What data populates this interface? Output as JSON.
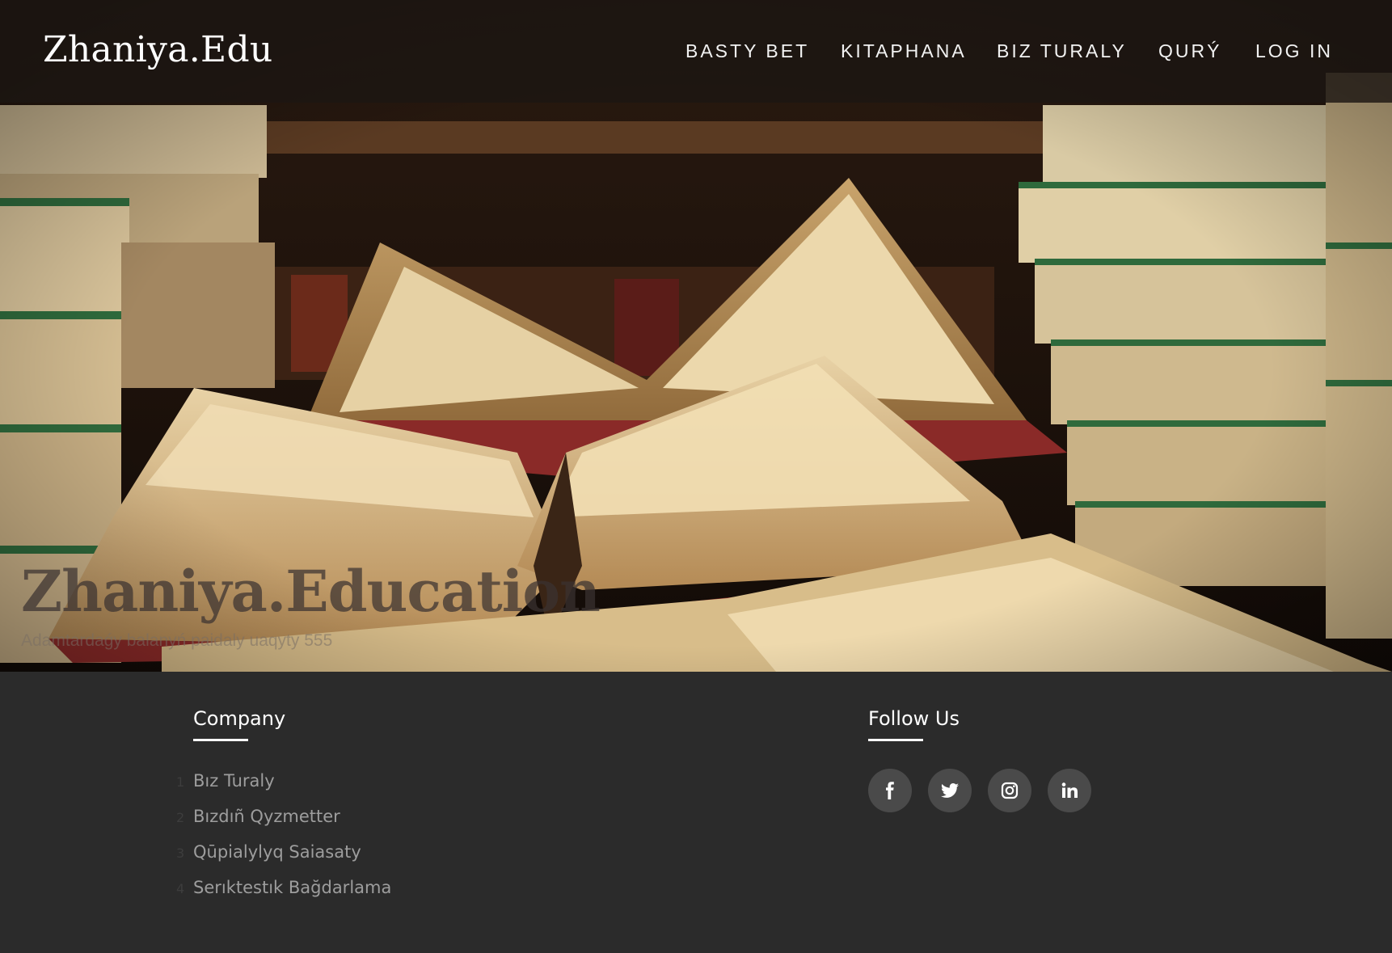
{
  "header": {
    "logo": "Zhaniya.Edu",
    "nav": [
      {
        "label": "BASTY BET"
      },
      {
        "label": "KITAPHANA"
      },
      {
        "label": "BIZ TURALY"
      },
      {
        "label": "QURÝ"
      },
      {
        "label": "LOG IN"
      }
    ]
  },
  "hero": {
    "title": "Zhaniya.Education",
    "subtitle": "Adamtardaǵy balanyń paidaly uaqyty 555"
  },
  "footer": {
    "company": {
      "title": "Company",
      "links": [
        {
          "num": "1",
          "label": "Bız Turaly"
        },
        {
          "num": "2",
          "label": "Bızdıñ Qyzmetter"
        },
        {
          "num": "3",
          "label": "Qūpialylyq Saiasaty"
        },
        {
          "num": "4",
          "label": "Serıktestık Bağdarlama"
        }
      ]
    },
    "follow": {
      "title": "Follow Us",
      "icons": [
        "facebook-icon",
        "twitter-icon",
        "instagram-icon",
        "linkedin-icon"
      ]
    }
  },
  "colors": {
    "navbar_bg": "#1c1612",
    "footer_bg": "#2b2b2b",
    "social_bg": "#4a4a4a",
    "text_light": "#ffffff",
    "link_muted": "#9d9d9d"
  }
}
